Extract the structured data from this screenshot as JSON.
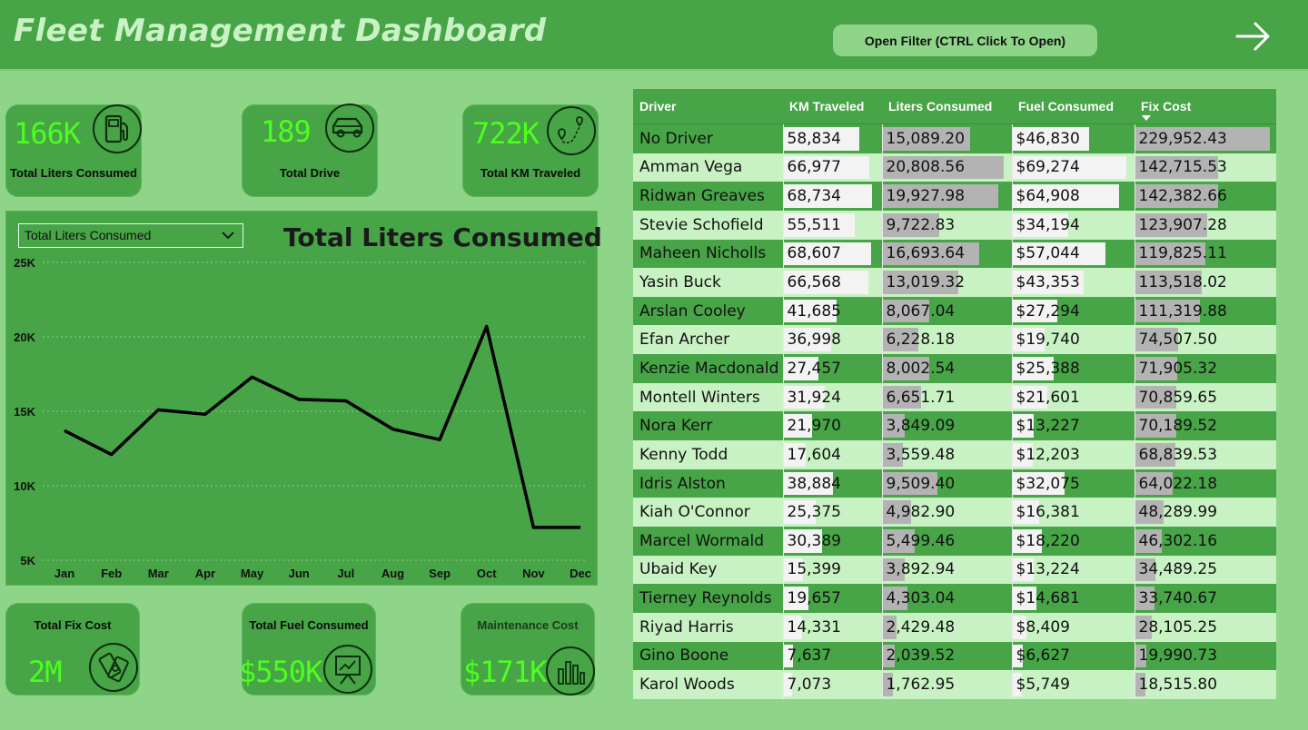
{
  "header": {
    "title": "Fleet Management Dashboard",
    "filter_button": "Open Filter (CTRL Click To Open)",
    "next_icon": "arrow-right-icon"
  },
  "kpis_top": [
    {
      "value": "166K",
      "label": "Total Liters Consumed",
      "icon": "fuel-pump-icon"
    },
    {
      "value": "189",
      "label": "Total Drive",
      "icon": "car-icon"
    },
    {
      "value": "722K",
      "label": "Total KM Traveled",
      "icon": "route-icon"
    }
  ],
  "kpis_bottom": [
    {
      "value": "2M",
      "label": "Total Fix Cost",
      "icon": "money-icon"
    },
    {
      "value": "$550K",
      "label": "Total Fuel Consumed",
      "icon": "presentation-icon"
    },
    {
      "value": "$171K",
      "label": "Maintenance Cost",
      "icon": "bar-chart-icon"
    }
  ],
  "chart_selector": {
    "selected": "Total Liters Consumed"
  },
  "colors": {
    "header_bg": "#47a447",
    "page_bg": "#8ed489",
    "kpi_value": "#4cff1e",
    "title_text": "#c9f2c4",
    "row_light": "#c9f2c4",
    "row_dark": "#47a447"
  },
  "chart_data": {
    "type": "line",
    "title": "Total Liters Consumed",
    "categories": [
      "Jan",
      "Feb",
      "Mar",
      "Apr",
      "May",
      "Jun",
      "Jul",
      "Aug",
      "Sep",
      "Oct",
      "Nov",
      "Dec"
    ],
    "series": [
      {
        "values": [
          13700,
          12100,
          15100,
          14800,
          17300,
          15800,
          15700,
          13800,
          13100,
          20700,
          7200,
          7200
        ]
      }
    ],
    "yticks": [
      "5K",
      "10K",
      "15K",
      "20K",
      "25K"
    ],
    "ylim": [
      5000,
      25000
    ],
    "grid": "horizontal dotted"
  },
  "table": {
    "columns": [
      "Driver",
      "KM Traveled",
      "Liters Consumed",
      "Fuel Consumed",
      "Fix Cost"
    ],
    "sorted_column": "Fix Cost",
    "rows": [
      {
        "driver": "No Driver",
        "km": "58,834",
        "liters": "15,089.20",
        "fuel": "$46,830",
        "fix": "229,952.43",
        "km_n": 58834,
        "liters_n": 15089.2,
        "fuel_n": 46830,
        "fix_n": 229952.43
      },
      {
        "driver": "Amman Vega",
        "km": "66,977",
        "liters": "20,808.56",
        "fuel": "$69,274",
        "fix": "142,715.53",
        "km_n": 66977,
        "liters_n": 20808.56,
        "fuel_n": 69274,
        "fix_n": 142715.53
      },
      {
        "driver": "Ridwan Greaves",
        "km": "68,734",
        "liters": "19,927.98",
        "fuel": "$64,908",
        "fix": "142,382.66",
        "km_n": 68734,
        "liters_n": 19927.98,
        "fuel_n": 64908,
        "fix_n": 142382.66
      },
      {
        "driver": "Stevie Schofield",
        "km": "55,511",
        "liters": "9,722.83",
        "fuel": "$34,194",
        "fix": "123,907.28",
        "km_n": 55511,
        "liters_n": 9722.83,
        "fuel_n": 34194,
        "fix_n": 123907.28
      },
      {
        "driver": "Maheen Nicholls",
        "km": "68,607",
        "liters": "16,693.64",
        "fuel": "$57,044",
        "fix": "119,825.11",
        "km_n": 68607,
        "liters_n": 16693.64,
        "fuel_n": 57044,
        "fix_n": 119825.11
      },
      {
        "driver": "Yasin Buck",
        "km": "66,568",
        "liters": "13,019.32",
        "fuel": "$43,353",
        "fix": "113,518.02",
        "km_n": 66568,
        "liters_n": 13019.32,
        "fuel_n": 43353,
        "fix_n": 113518.02
      },
      {
        "driver": "Arslan Cooley",
        "km": "41,685",
        "liters": "8,067.04",
        "fuel": "$27,294",
        "fix": "111,319.88",
        "km_n": 41685,
        "liters_n": 8067.04,
        "fuel_n": 27294,
        "fix_n": 111319.88
      },
      {
        "driver": "Efan Archer",
        "km": "36,998",
        "liters": "6,228.18",
        "fuel": "$19,740",
        "fix": "74,507.50",
        "km_n": 36998,
        "liters_n": 6228.18,
        "fuel_n": 19740,
        "fix_n": 74507.5
      },
      {
        "driver": "Kenzie Macdonald",
        "km": "27,457",
        "liters": "8,002.54",
        "fuel": "$25,388",
        "fix": "71,905.32",
        "km_n": 27457,
        "liters_n": 8002.54,
        "fuel_n": 25388,
        "fix_n": 71905.32
      },
      {
        "driver": "Montell Winters",
        "km": "31,924",
        "liters": "6,651.71",
        "fuel": "$21,601",
        "fix": "70,859.65",
        "km_n": 31924,
        "liters_n": 6651.71,
        "fuel_n": 21601,
        "fix_n": 70859.65
      },
      {
        "driver": "Nora Kerr",
        "km": "21,970",
        "liters": "3,849.09",
        "fuel": "$13,227",
        "fix": "70,189.52",
        "km_n": 21970,
        "liters_n": 3849.09,
        "fuel_n": 13227,
        "fix_n": 70189.52
      },
      {
        "driver": "Kenny Todd",
        "km": "17,604",
        "liters": "3,559.48",
        "fuel": "$12,203",
        "fix": "68,839.53",
        "km_n": 17604,
        "liters_n": 3559.48,
        "fuel_n": 12203,
        "fix_n": 68839.53
      },
      {
        "driver": "Idris Alston",
        "km": "38,884",
        "liters": "9,509.40",
        "fuel": "$32,075",
        "fix": "64,022.18",
        "km_n": 38884,
        "liters_n": 9509.4,
        "fuel_n": 32075,
        "fix_n": 64022.18
      },
      {
        "driver": "Kiah O'Connor",
        "km": "25,375",
        "liters": "4,982.90",
        "fuel": "$16,381",
        "fix": "48,289.99",
        "km_n": 25375,
        "liters_n": 4982.9,
        "fuel_n": 16381,
        "fix_n": 48289.99
      },
      {
        "driver": "Marcel Wormald",
        "km": "30,389",
        "liters": "5,499.46",
        "fuel": "$18,220",
        "fix": "46,302.16",
        "km_n": 30389,
        "liters_n": 5499.46,
        "fuel_n": 18220,
        "fix_n": 46302.16
      },
      {
        "driver": "Ubaid Key",
        "km": "15,399",
        "liters": "3,892.94",
        "fuel": "$13,224",
        "fix": "34,489.25",
        "km_n": 15399,
        "liters_n": 3892.94,
        "fuel_n": 13224,
        "fix_n": 34489.25
      },
      {
        "driver": "Tierney Reynolds",
        "km": "19,657",
        "liters": "4,303.04",
        "fuel": "$14,681",
        "fix": "33,740.67",
        "km_n": 19657,
        "liters_n": 4303.04,
        "fuel_n": 14681,
        "fix_n": 33740.67
      },
      {
        "driver": "Riyad Harris",
        "km": "14,331",
        "liters": "2,429.48",
        "fuel": "$8,409",
        "fix": "28,105.25",
        "km_n": 14331,
        "liters_n": 2429.48,
        "fuel_n": 8409,
        "fix_n": 28105.25
      },
      {
        "driver": "Gino Boone",
        "km": "7,637",
        "liters": "2,039.52",
        "fuel": "$6,627",
        "fix": "19,990.73",
        "km_n": 7637,
        "liters_n": 2039.52,
        "fuel_n": 6627,
        "fix_n": 19990.73
      },
      {
        "driver": "Karol Woods",
        "km": "7,073",
        "liters": "1,762.95",
        "fuel": "$5,749",
        "fix": "18,515.80",
        "km_n": 7073,
        "liters_n": 1762.95,
        "fuel_n": 5749,
        "fix_n": 18515.8
      }
    ]
  }
}
